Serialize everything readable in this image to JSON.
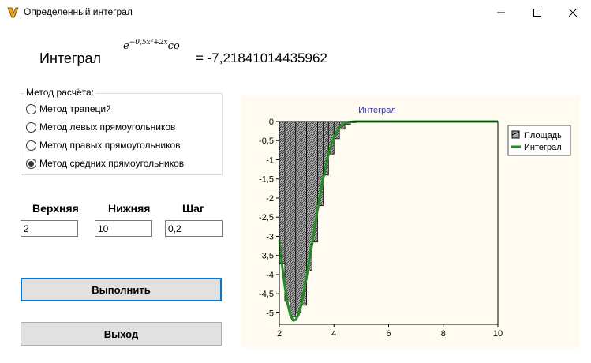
{
  "window": {
    "title": "Определенный интеграл",
    "app_icon": "app-icon",
    "controls": [
      "minimize-icon",
      "maximize-icon",
      "close-icon"
    ]
  },
  "formula": {
    "label": "Интеграл",
    "base": "e",
    "exponent": "−0,5x²+2x",
    "suffix": "co",
    "result": "= -7,21841014435962"
  },
  "method_group": {
    "title": "Метод расчёта:",
    "options": [
      {
        "label": "Метод трапеций",
        "checked": false
      },
      {
        "label": "Метод левых прямоугольников",
        "checked": false
      },
      {
        "label": "Метод правых прямоугольников",
        "checked": false
      },
      {
        "label": "Метод средних прямоугольников",
        "checked": true
      }
    ]
  },
  "bounds": {
    "upper_label": "Верхняя",
    "lower_label": "Нижняя",
    "step_label": "Шаг",
    "upper_value": "2",
    "lower_value": "10",
    "step_value": "0,2"
  },
  "buttons": {
    "run": "Выполнить",
    "exit": "Выход"
  },
  "colors": {
    "title_text": "#3333cc",
    "line": "#228b22",
    "bar_fill": "#a9a9a9",
    "panel_bg": "#fffbf0",
    "focus_border": "#0078d7"
  },
  "chart_data": {
    "type": "bar",
    "title": "Интеграл",
    "xlim": [
      2,
      10
    ],
    "ylim": [
      -5.3,
      0
    ],
    "x_ticks": [
      "2",
      "4",
      "6",
      "8",
      "10"
    ],
    "y_ticks": [
      "0",
      "-0,5",
      "-1",
      "-1,5",
      "-2",
      "-2,5",
      "-3",
      "-3,5",
      "-4",
      "-4,5",
      "-5"
    ],
    "grid": false,
    "legend_placement": "top-right",
    "series": [
      {
        "name": "Площадь",
        "type": "bar",
        "x": [
          2.1,
          2.3,
          2.5,
          2.7,
          2.9,
          3.1,
          3.3,
          3.5,
          3.7,
          3.9,
          4.1,
          4.3,
          4.5,
          4.7,
          4.9,
          5.1,
          5.3,
          5.5,
          5.7,
          5.9,
          6.1,
          6.3,
          6.5,
          6.7,
          6.9,
          7.1,
          7.3,
          7.5,
          7.7,
          7.9,
          8.1,
          8.3,
          8.5,
          8.7,
          8.9,
          9.1,
          9.3,
          9.5,
          9.7,
          9.9
        ],
        "values": [
          -3.7,
          -4.7,
          -5.1,
          -5.0,
          -4.8,
          -3.9,
          -3.15,
          -2.2,
          -1.4,
          -0.85,
          -0.45,
          -0.2,
          -0.08,
          -0.03,
          -0.01,
          0,
          0,
          0,
          0,
          0,
          0,
          0,
          0,
          0,
          0,
          0,
          0,
          0,
          0,
          0,
          0,
          0,
          0,
          0,
          0,
          0,
          0,
          0,
          0,
          0
        ]
      },
      {
        "name": "Интеграл",
        "type": "line",
        "x": [
          2.0,
          2.1,
          2.2,
          2.3,
          2.4,
          2.5,
          2.6,
          2.7,
          2.8,
          2.9,
          3.0,
          3.2,
          3.4,
          3.6,
          3.8,
          4.0,
          4.2,
          4.4,
          4.6,
          4.8,
          5.0,
          5.5,
          6.0,
          7.0,
          8.0,
          9.0,
          10.0
        ],
        "values": [
          -3.1,
          -3.75,
          -4.3,
          -4.75,
          -5.05,
          -5.2,
          -5.18,
          -5.05,
          -4.8,
          -4.45,
          -4.05,
          -3.2,
          -2.3,
          -1.5,
          -0.85,
          -0.4,
          -0.15,
          -0.04,
          -0.01,
          0,
          0,
          0,
          0,
          0,
          0,
          0,
          0
        ]
      }
    ]
  }
}
